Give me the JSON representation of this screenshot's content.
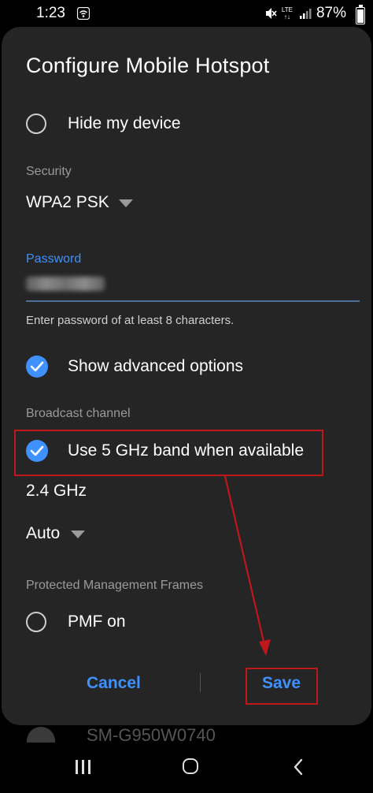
{
  "status_bar": {
    "time": "1:23",
    "network": "LTE",
    "battery": "87%",
    "battery_level": 0.87
  },
  "dialog": {
    "title": "Configure Mobile Hotspot",
    "hide_device": {
      "label": "Hide my device",
      "checked": false
    },
    "security": {
      "label": "Security",
      "value": "WPA2 PSK"
    },
    "password": {
      "label": "Password",
      "hint": "Enter password of at least 8 characters."
    },
    "advanced": {
      "label": "Show advanced options",
      "checked": true
    },
    "broadcast": {
      "label": "Broadcast channel",
      "band5": {
        "label": "Use 5 GHz band when available",
        "checked": true
      },
      "band": "2.4 GHz",
      "channel": "Auto"
    },
    "pmf": {
      "section_label": "Protected Management Frames",
      "label": "PMF on",
      "checked": false
    },
    "buttons": {
      "cancel": "Cancel",
      "save": "Save"
    }
  },
  "background": {
    "device_name": "SM-G950W0740"
  },
  "colors": {
    "accent": "#3e91ff",
    "annotation": "#c0171b",
    "dialog_bg": "#252525"
  }
}
